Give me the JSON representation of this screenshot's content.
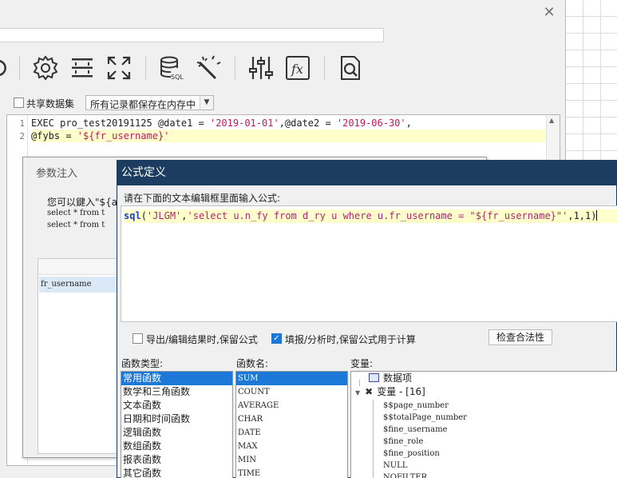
{
  "dataset_dialog": {
    "close_glyph": "✕",
    "share_dataset_label": "共享数据集",
    "storage_mode": "所有记录都保存在内存中",
    "sql_lines": [
      {
        "n": "1",
        "prefix": "EXEC pro_test20191125 @date1 = ",
        "s1": "'2019-01-01'",
        "mid": ",@date2 = ",
        "s2": "'2019-06-30'",
        "suffix": ","
      },
      {
        "n": "2",
        "prefix": "@fybs = ",
        "s1": "'${fr_username}'"
      }
    ],
    "toolbar_icons": [
      "refresh-icon",
      "settings-icon",
      "split-icon",
      "expand-icon",
      "database-sql-icon",
      "magic-wand-icon",
      "sliders-icon",
      "formula-fx-icon",
      "search-doc-icon"
    ]
  },
  "param_dialog": {
    "title": "参数注入",
    "hint": "您可以鍵入\"${a",
    "line1": "select * from t",
    "line2": "select * from t",
    "param_row": "fr_username"
  },
  "formula_dialog": {
    "title": "公式定义",
    "prompt": "请在下面的文本编辑框里面输入公式:",
    "formula": {
      "fn": "sql",
      "open": "(",
      "s1": "'JLGM'",
      "comma": ",",
      "s2": "'select u.n_fy from d_ry u where u.fr_username = \"${fr_username}\"'",
      "rest": ",1,1)"
    },
    "export_label": "导出/编辑结果时,保留公式",
    "fill_label": "填报/分析时,保留公式用于计算",
    "check_button": "检查合法性",
    "func_type_label": "函数类型:",
    "func_name_label": "函数名:",
    "variable_label": "变量:",
    "func_types": [
      "常用函数",
      "数学和三角函数",
      "文本函数",
      "日期和时间函数",
      "逻辑函数",
      "数组函数",
      "报表函数",
      "其它函数"
    ],
    "func_names": [
      "SUM",
      "COUNT",
      "AVERAGE",
      "CHAR",
      "DATE",
      "MAX",
      "MIN",
      "TIME"
    ],
    "variables": {
      "data_items": "数据项",
      "vars_label": "变量 - [16]",
      "items": [
        "$$page_number",
        "$$totalPage_number",
        "$fine_username",
        "$fine_role",
        "$fine_position",
        "NULL",
        "NOFILTER"
      ]
    }
  }
}
